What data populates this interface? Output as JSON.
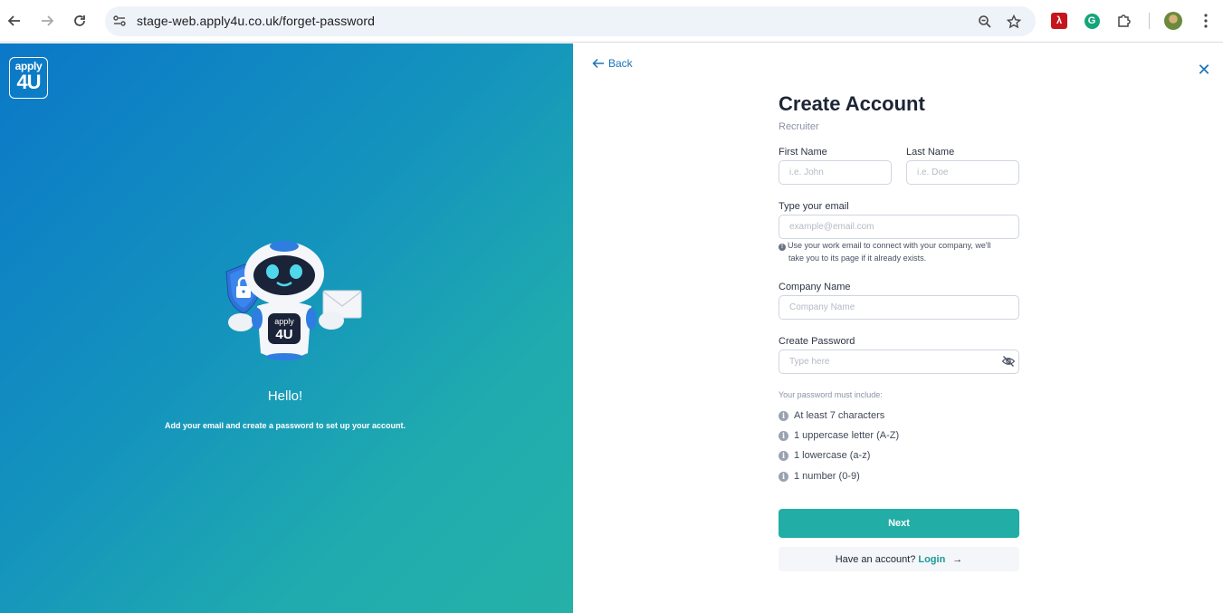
{
  "browser": {
    "url": "stage-web.apply4u.co.uk/forget-password"
  },
  "hero": {
    "logo_line1": "apply",
    "logo_line2": "4U",
    "robot_badge_line1": "apply",
    "robot_badge_line2": "4U",
    "greeting": "Hello!",
    "subtitle": "Add your email and create a password to set up your account."
  },
  "form": {
    "back_label": "Back",
    "title": "Create Account",
    "subtitle": "Recruiter",
    "first_name_label": "First Name",
    "first_name_placeholder": "i.e. John",
    "last_name_label": "Last Name",
    "last_name_placeholder": "i.e. Doe",
    "email_label": "Type your email",
    "email_placeholder": "example@email.com",
    "email_hint_line1": "Use your work email to connect with your company, we'll",
    "email_hint_line2": "take you to its page if it already exists.",
    "company_label": "Company Name",
    "company_placeholder": "Company Name",
    "password_label": "Create Password",
    "password_placeholder": "Type here",
    "rules_title": "Your password must include:",
    "rules": [
      "At least 7 characters",
      "1 uppercase letter (A-Z)",
      "1 lowercase (a-z)",
      "1 number (0-9)"
    ],
    "next_label": "Next",
    "have_account_text": "Have an account?",
    "login_label": "Login"
  },
  "colors": {
    "accent": "#22ada6",
    "link": "#1b74b8",
    "hero_start": "#0b78c8",
    "hero_end": "#25b1a8"
  }
}
